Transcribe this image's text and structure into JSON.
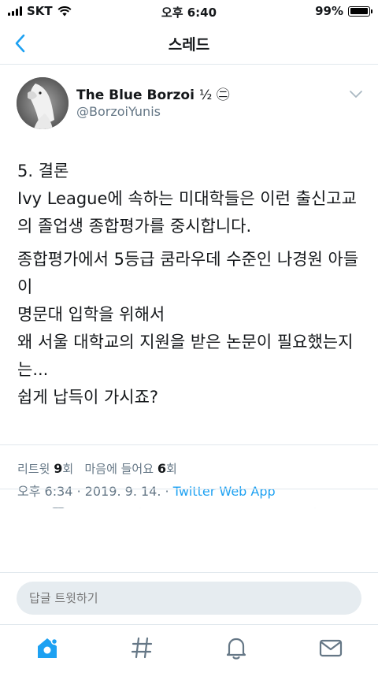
{
  "status_bar": {
    "carrier": "SKT",
    "time": "오후 6:40",
    "battery_percent": "99%",
    "battery_level": 0.99
  },
  "nav": {
    "title": "스레드"
  },
  "tweet": {
    "display_name": "The Blue Borzoi",
    "name_emoji": "½ ㊁",
    "handle": "@BorzoiYunis",
    "paragraph1": [
      "5. 결론",
      "Ivy League에 속하는 미대학들은 이런 출신고교의 졸업생 종합평가를 중시합니다."
    ],
    "paragraph2": [
      "종합평가에서 5등급 쿰라우데 수준인 나경원 아들이",
      "명문대 입학을 위해서",
      "왜 서울 대학교의 지원을 받은 논문이 필요했는지는...",
      "쉽게 납득이 가시죠?"
    ],
    "meta": {
      "time": "오후 6:34",
      "date": "2019. 9. 14.",
      "source": "Twitter Web App",
      "sep": "·"
    },
    "stats": {
      "retweet_label": "리트윗",
      "retweet_count": "9",
      "retweet_unit": "회",
      "like_label": "마음에 들어요",
      "like_count": "6",
      "like_unit": "회"
    }
  },
  "reply": {
    "placeholder": "답글 트윗하기"
  },
  "tabs": [
    "home-icon",
    "explore-hashtag-icon",
    "notifications-bell-icon",
    "messages-envelope-icon"
  ],
  "colors": {
    "accent": "#1da1f2",
    "secondary_text": "#657786",
    "divider": "#e1e8ed",
    "input_bg": "#e6ecf0"
  }
}
